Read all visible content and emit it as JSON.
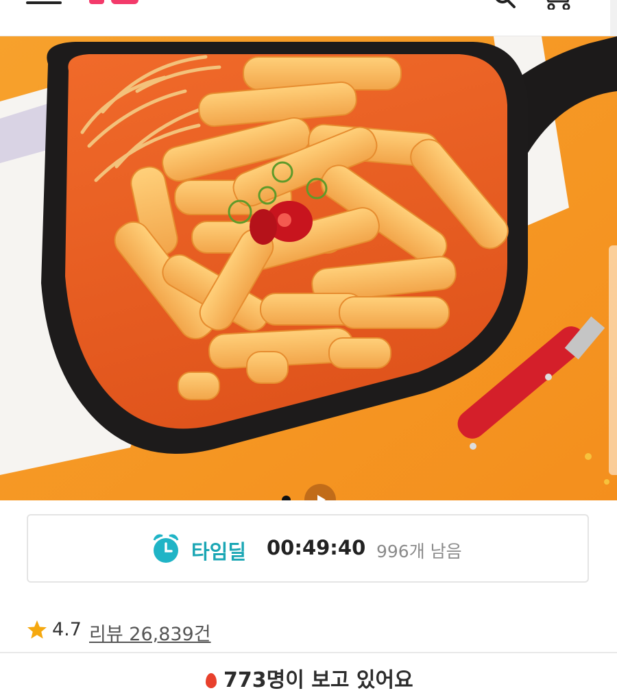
{
  "header": {
    "menu_icon": "hamburger-menu-icon",
    "logo_icon": "brand-logo",
    "search_icon": "search-icon",
    "cart_icon": "cart-icon"
  },
  "hero": {
    "image_icon": "product-photo-tteokbokki",
    "carousel_dot": "carousel-dot-icon",
    "video_play": "play-video-icon"
  },
  "time_deal": {
    "icon": "alarm-clock-icon",
    "label": "타임딜",
    "countdown": "00:49:40",
    "remaining": "996개 남음"
  },
  "rating": {
    "icon": "star-icon",
    "score": "4.7",
    "review_link": "리뷰 26,839건"
  },
  "bottom_banner": {
    "icon": "fire-icon",
    "text": "773명이 보고 있어요"
  },
  "colors": {
    "accent_time_deal": "#1aa6b4",
    "star": "#f5a80f",
    "hero_background": "#f79a25",
    "brand": "#f33a6a"
  }
}
